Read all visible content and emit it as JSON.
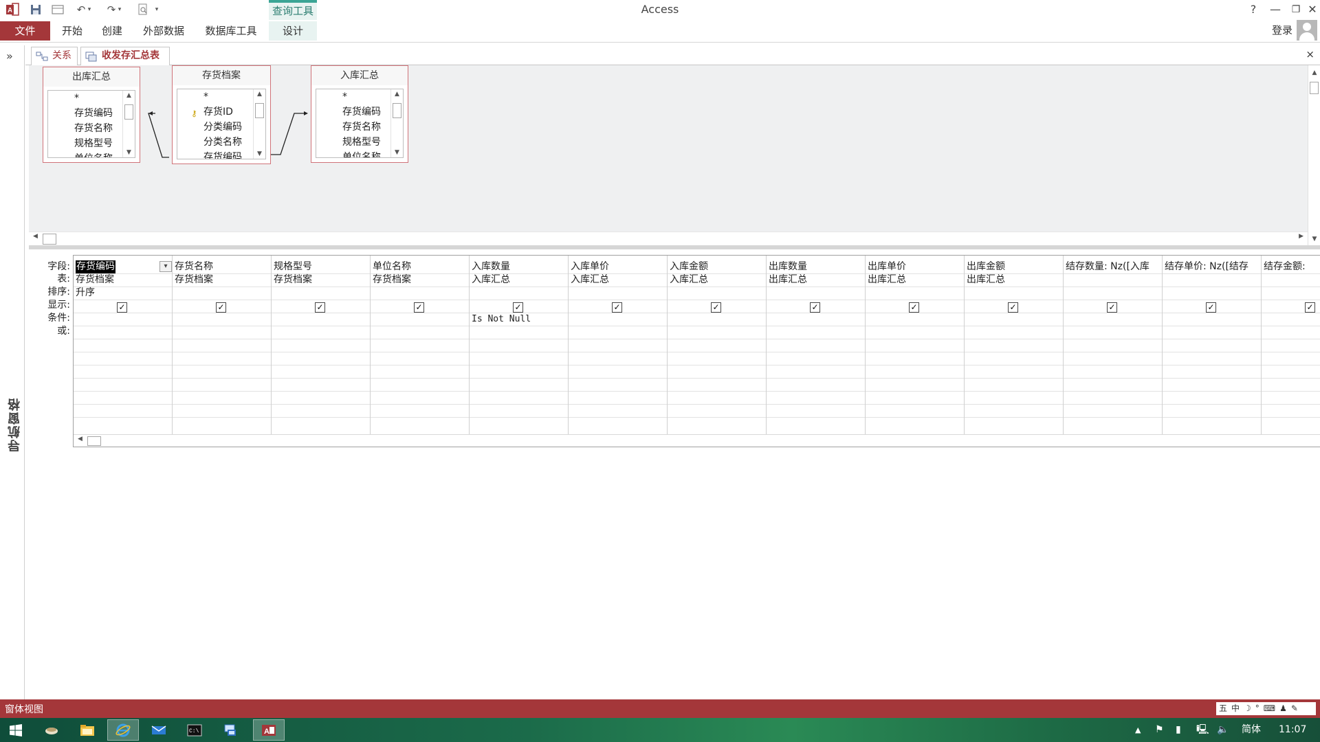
{
  "app": {
    "title": "Access",
    "context_tab_group": "查询工具",
    "help": "?",
    "minimize": "—",
    "restore": "❐",
    "close": "✕"
  },
  "ribbon": {
    "tabs": [
      "文件",
      "开始",
      "创建",
      "外部数据",
      "数据库工具",
      "设计"
    ],
    "login": "登录"
  },
  "nav_pane": {
    "label": "导航窗格",
    "expand": "»"
  },
  "doc_tabs": [
    {
      "label": "关系",
      "active": false
    },
    {
      "label": "收发存汇总表",
      "active": true
    }
  ],
  "doc_close": "×",
  "tables": [
    {
      "title": "出库汇总",
      "fields": [
        "*",
        "存货编码",
        "存货名称",
        "规格型号",
        "单位名称"
      ]
    },
    {
      "title": "存货档案",
      "fields": [
        "*",
        "存货ID",
        "分类编码",
        "分类名称",
        "存货编码"
      ],
      "key_field": 1
    },
    {
      "title": "入库汇总",
      "fields": [
        "*",
        "存货编码",
        "存货名称",
        "规格型号",
        "单位名称"
      ]
    }
  ],
  "grid": {
    "row_labels": [
      "字段:",
      "表:",
      "排序:",
      "显示:",
      "条件:",
      "或:"
    ],
    "columns": [
      {
        "field": "存货编码",
        "table": "存货档案",
        "sort": "升序",
        "show": true,
        "criteria": "",
        "selected": true
      },
      {
        "field": "存货名称",
        "table": "存货档案",
        "sort": "",
        "show": true,
        "criteria": ""
      },
      {
        "field": "规格型号",
        "table": "存货档案",
        "sort": "",
        "show": true,
        "criteria": ""
      },
      {
        "field": "单位名称",
        "table": "存货档案",
        "sort": "",
        "show": true,
        "criteria": ""
      },
      {
        "field": "入库数量",
        "table": "入库汇总",
        "sort": "",
        "show": true,
        "criteria": "Is Not Null"
      },
      {
        "field": "入库单价",
        "table": "入库汇总",
        "sort": "",
        "show": true,
        "criteria": ""
      },
      {
        "field": "入库金额",
        "table": "入库汇总",
        "sort": "",
        "show": true,
        "criteria": ""
      },
      {
        "field": "出库数量",
        "table": "出库汇总",
        "sort": "",
        "show": true,
        "criteria": ""
      },
      {
        "field": "出库单价",
        "table": "出库汇总",
        "sort": "",
        "show": true,
        "criteria": ""
      },
      {
        "field": "出库金额",
        "table": "出库汇总",
        "sort": "",
        "show": true,
        "criteria": ""
      },
      {
        "field": "结存数量: Nz([入库",
        "table": "",
        "sort": "",
        "show": true,
        "criteria": ""
      },
      {
        "field": "结存单价: Nz([结存",
        "table": "",
        "sort": "",
        "show": true,
        "criteria": ""
      },
      {
        "field": "结存金额:",
        "table": "",
        "sort": "",
        "show": true,
        "criteria": ""
      }
    ]
  },
  "status": {
    "text": "窗体视图",
    "ime": [
      "五",
      "中",
      "☽",
      "°",
      "⌨",
      "♟",
      "✎"
    ]
  },
  "taskbar": {
    "lang": "简体",
    "time": "11:07"
  },
  "colors": {
    "access_red": "#a4373a",
    "context_teal": "#3ba595",
    "table_border": "#d07278"
  }
}
